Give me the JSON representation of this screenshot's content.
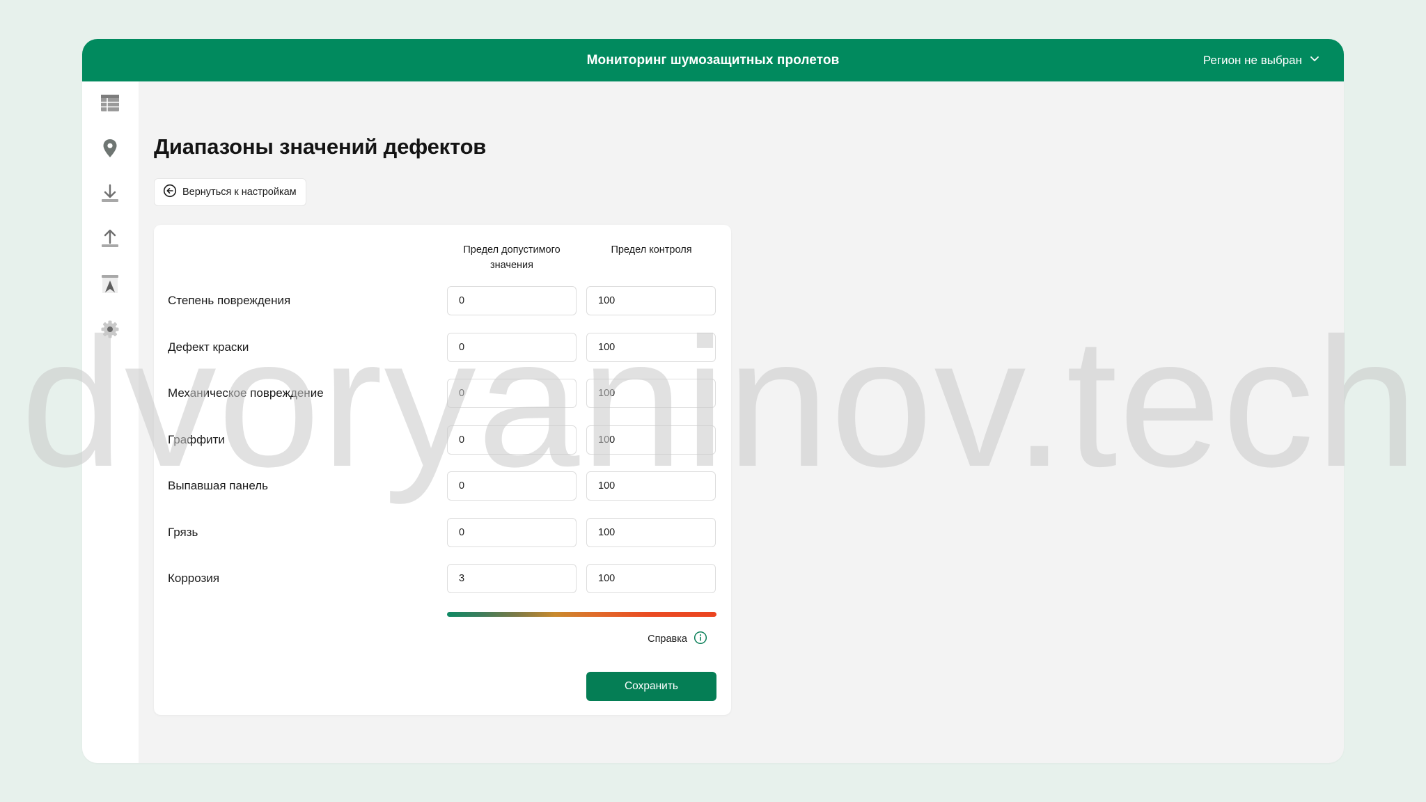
{
  "header": {
    "title": "Мониторинг шумозащитных пролетов",
    "region_label": "Регион не выбран"
  },
  "sidebar": {
    "items": [
      {
        "icon": "table-icon"
      },
      {
        "icon": "map-pin-icon"
      },
      {
        "icon": "download-icon"
      },
      {
        "icon": "upload-icon"
      },
      {
        "icon": "route-icon"
      },
      {
        "icon": "gear-icon"
      }
    ]
  },
  "page": {
    "title": "Диапазоны значений дефектов",
    "back_label": "Вернуться к настройкам"
  },
  "table": {
    "col_allowed": "Предел допустимого значения",
    "col_control": "Предел контроля",
    "rows": [
      {
        "label": "Степень повреждения",
        "allowed": "0",
        "control": "100"
      },
      {
        "label": "Дефект краски",
        "allowed": "0",
        "control": "100"
      },
      {
        "label": "Механическое повреждение",
        "allowed": "0",
        "control": "100"
      },
      {
        "label": "Граффити",
        "allowed": "0",
        "control": "100"
      },
      {
        "label": "Выпавшая панель",
        "allowed": "0",
        "control": "100"
      },
      {
        "label": "Грязь",
        "allowed": "0",
        "control": "100"
      },
      {
        "label": "Коррозия",
        "allowed": "3",
        "control": "100"
      }
    ]
  },
  "help_label": "Справка",
  "save_label": "Сохранить",
  "watermark": "dvoryaninov.tech",
  "colors": {
    "brand": "#018a5e",
    "button": "#057e55",
    "background": "#e7f1ec",
    "surface": "#f3f3f3"
  }
}
